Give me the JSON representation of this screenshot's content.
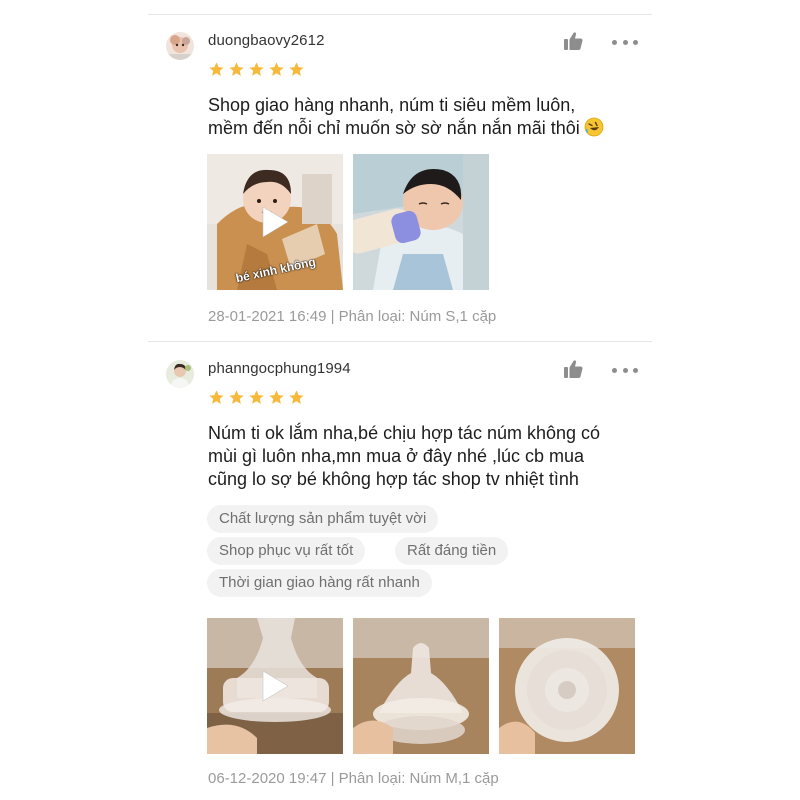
{
  "reviews": [
    {
      "username": "duongbaovy2612",
      "rating": 5,
      "comment_lines": [
        "Shop giao hàng nhanh, núm ti siêu mềm luôn,",
        "mềm đến nỗi chỉ muốn sờ sờ nắn nắn mãi thôi"
      ],
      "emoji": "rofl-emoji",
      "media": [
        {
          "kind": "video",
          "overlay_text": "bé xinh không",
          "subject": "toddler-in-jacket"
        },
        {
          "kind": "image",
          "subject": "baby-drinking-bottle"
        }
      ],
      "meta": "28-01-2021 16:49 | Phân loại: Núm S,1 cặp"
    },
    {
      "username": "phanngocphung1994",
      "rating": 5,
      "comment_lines": [
        "Núm ti ok lắm nha,bé chịu hợp tác núm không có",
        "mùi gì luôn nha,mn mua ở đây nhé ,lúc cb mua",
        "cũng lo sợ bé không hợp tác shop tv nhiệt tình"
      ],
      "tags": [
        "Chất lượng sản phẩm tuyệt vời",
        "Shop phục vụ rất tốt",
        "Rất đáng tiền",
        "Thời gian giao hàng rất nhanh"
      ],
      "media": [
        {
          "kind": "video",
          "subject": "silicone-nipple-side"
        },
        {
          "kind": "image",
          "subject": "silicone-nipple-front"
        },
        {
          "kind": "image",
          "subject": "silicone-nipple-top"
        }
      ],
      "meta": "06-12-2020 19:47 | Phân loại: Núm M,1 cặp"
    }
  ],
  "icons": {
    "like": "thumbs-up-icon",
    "more": "more-options-icon",
    "star": "star-icon",
    "play": "play-icon"
  },
  "colors": {
    "star": "#f6b93b",
    "icon_gray": "#8d8d8d",
    "meta_text": "#9a9a9a",
    "tag_bg": "#f2f2f2"
  }
}
